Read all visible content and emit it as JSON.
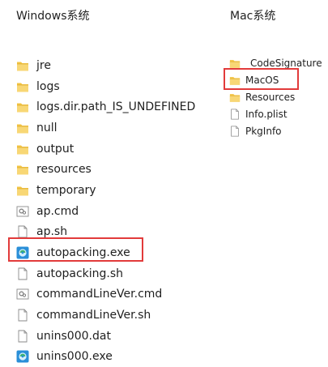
{
  "windows": {
    "heading": "Windows系统",
    "items": [
      {
        "label": "jre",
        "icon": "folder-icon"
      },
      {
        "label": "logs",
        "icon": "folder-icon"
      },
      {
        "label": "logs.dir.path_IS_UNDEFINED",
        "icon": "folder-icon"
      },
      {
        "label": "null",
        "icon": "folder-icon"
      },
      {
        "label": "output",
        "icon": "folder-icon"
      },
      {
        "label": "resources",
        "icon": "folder-icon"
      },
      {
        "label": "temporary",
        "icon": "folder-icon"
      },
      {
        "label": "ap.cmd",
        "icon": "cmd-file-icon"
      },
      {
        "label": "ap.sh",
        "icon": "blank-file-icon"
      },
      {
        "label": "autopacking.exe",
        "icon": "exe-app-icon"
      },
      {
        "label": "autopacking.sh",
        "icon": "blank-file-icon"
      },
      {
        "label": "commandLineVer.cmd",
        "icon": "cmd-file-icon"
      },
      {
        "label": "commandLineVer.sh",
        "icon": "blank-file-icon"
      },
      {
        "label": "unins000.dat",
        "icon": "blank-file-icon"
      },
      {
        "label": "unins000.exe",
        "icon": "exe-app-icon"
      }
    ]
  },
  "mac": {
    "heading": "Mac系统",
    "items": [
      {
        "label": "_CodeSignature",
        "icon": "folder-icon"
      },
      {
        "label": "MacOS",
        "icon": "folder-icon"
      },
      {
        "label": "Resources",
        "icon": "folder-icon"
      },
      {
        "label": "Info.plist",
        "icon": "blank-file-icon"
      },
      {
        "label": "PkgInfo",
        "icon": "blank-file-icon"
      }
    ]
  },
  "colors": {
    "highlight": "#e23b3b",
    "folder": "#f3c443",
    "exe_blue": "#2a8fd8"
  }
}
